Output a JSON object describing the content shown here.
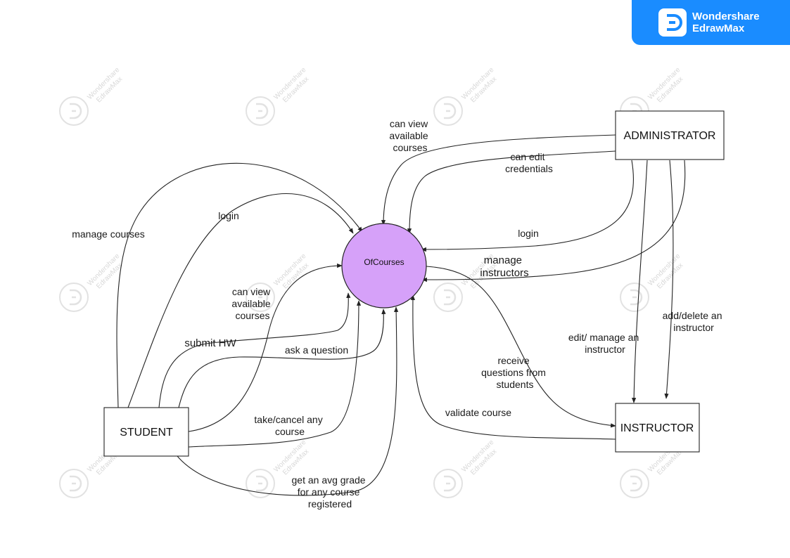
{
  "brand": {
    "line1": "Wondershare",
    "line2": "EdrawMax"
  },
  "watermark": {
    "line1": "Wondershare",
    "line2": "EdrawMax"
  },
  "diagram": {
    "process": {
      "label": "OfCourses",
      "fill": "#d6a1f9"
    },
    "entities": {
      "administrator": "ADMINISTRATOR",
      "student": "STUDENT",
      "instructor": "INSTRUCTOR"
    },
    "flows": {
      "admin_view_courses": [
        "can view",
        "available",
        "courses"
      ],
      "admin_edit_credentials": [
        "can edit",
        "credentials"
      ],
      "admin_login": [
        "login"
      ],
      "admin_manage_instructors": [
        "manage",
        "instructors"
      ],
      "admin_edit_instructor": [
        "edit/ manage an",
        "instructor"
      ],
      "admin_add_delete_instructor": [
        "add/delete an",
        "instructor"
      ],
      "student_manage_courses": [
        "manage courses"
      ],
      "student_login": [
        "login"
      ],
      "student_view_courses": [
        "can view",
        "available",
        "courses"
      ],
      "student_submit_hw": [
        "submit HW"
      ],
      "student_ask_question": [
        "ask a question"
      ],
      "student_take_cancel": [
        "take/cancel any",
        "course"
      ],
      "student_avg_grade": [
        "get an avg grade",
        "for any course",
        "registered"
      ],
      "instructor_receive_questions": [
        "receive",
        "questions from",
        "students"
      ],
      "instructor_validate_course": [
        "validate course"
      ]
    }
  }
}
